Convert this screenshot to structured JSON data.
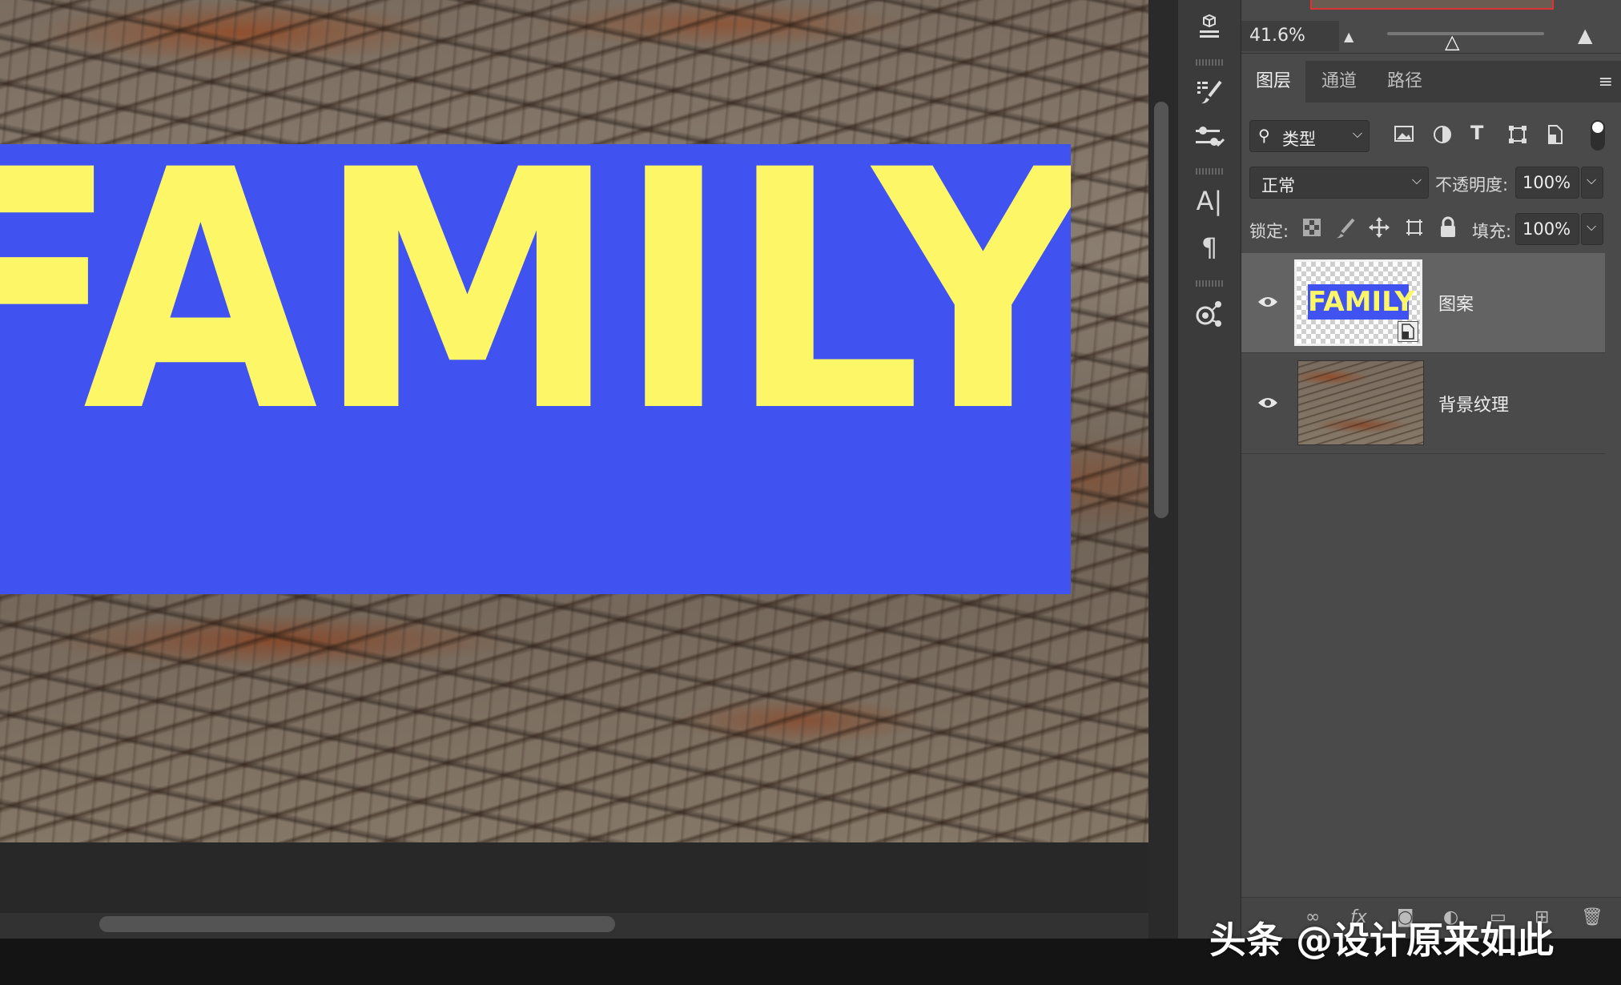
{
  "canvas": {
    "banner_text": "FAMILY",
    "colors": {
      "banner_bg": "#4052ef",
      "banner_text": "#fdf768"
    }
  },
  "tools": {
    "icons": [
      "3d-cube-icon",
      "brush-presets-icon",
      "adjust-sliders-icon",
      "character-icon",
      "paragraph-icon",
      "properties-icon"
    ],
    "char_glyph": "A|",
    "para_glyph": "¶"
  },
  "navigator": {
    "zoom": "41.6%"
  },
  "layers_panel": {
    "tabs": [
      {
        "label": "图层",
        "active": true
      },
      {
        "label": "通道",
        "active": false
      },
      {
        "label": "路径",
        "active": false
      }
    ],
    "filter": {
      "label": "类型"
    },
    "blend_mode": "正常",
    "opacity_label": "不透明度:",
    "opacity_value": "100%",
    "lock_label": "锁定:",
    "fill_label": "填充:",
    "fill_value": "100%",
    "filter_icons": [
      "image-filter-icon",
      "adjustment-filter-icon",
      "type-filter-icon",
      "shape-filter-icon",
      "smart-object-filter-icon"
    ],
    "type_icon_glyph": "T",
    "layers": [
      {
        "name": "图案",
        "thumb_text": "FAMILY",
        "selected": true,
        "visible": true,
        "smart_object": true
      },
      {
        "name": "背景纹理",
        "selected": false,
        "visible": true,
        "smart_object": false
      }
    ]
  },
  "watermark": "头条 @设计原来如此"
}
